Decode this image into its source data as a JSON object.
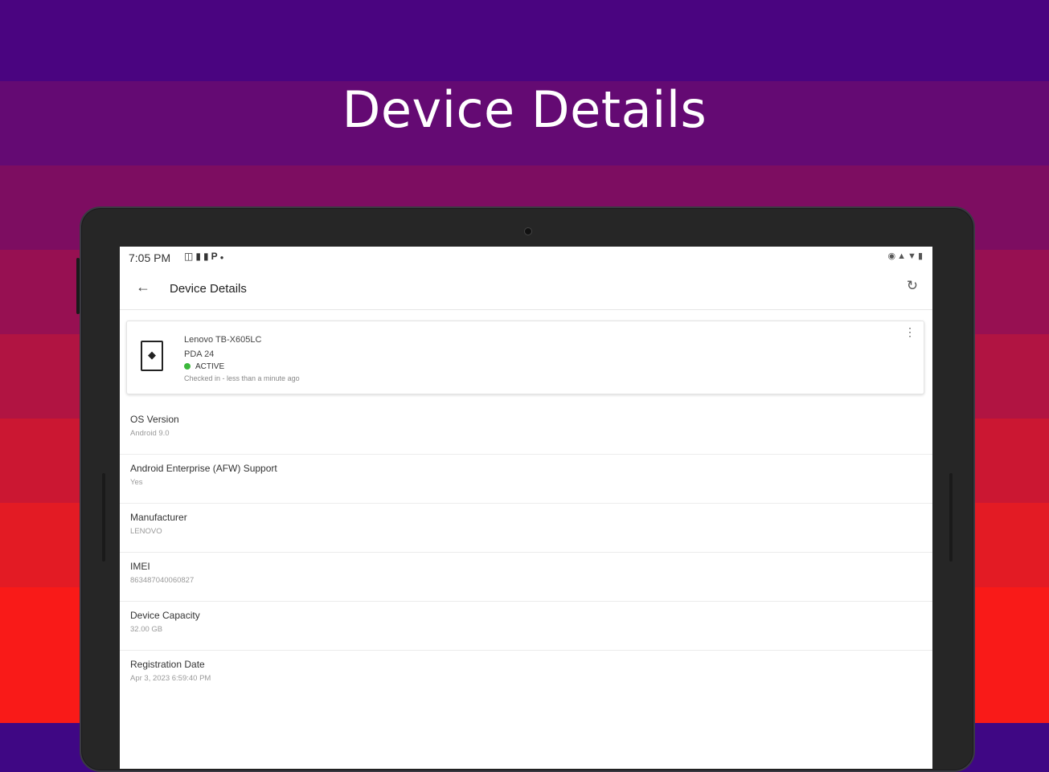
{
  "hero": {
    "title": "Device Details"
  },
  "colors": {
    "bands": [
      "#4a0480",
      "#640a73",
      "#7d0d61",
      "#971052",
      "#b11442",
      "#cb1732",
      "#e31b24",
      "#f91a18"
    ],
    "accent_active": "#3cb83c"
  },
  "status_bar": {
    "time": "7:05 PM",
    "left_icons": [
      "sim-icon",
      "folder-icon",
      "folder-icon",
      "parking-icon",
      "dot-icon"
    ],
    "right_icons": [
      "camera-icon",
      "signal-icon",
      "wifi-icon",
      "battery-icon"
    ]
  },
  "app_bar": {
    "title": "Device Details",
    "back_icon": "arrow-back-icon",
    "refresh_icon": "refresh-icon"
  },
  "device_card": {
    "model": "Lenovo TB-X605LC",
    "label": "PDA 24",
    "status": "ACTIVE",
    "checked_in": "Checked in - less than a minute ago",
    "icon": "android-tablet-icon",
    "menu_icon": "more-vert-icon"
  },
  "details": [
    {
      "label": "OS Version",
      "value": "Android 9.0"
    },
    {
      "label": "Android Enterprise (AFW) Support",
      "value": "Yes"
    },
    {
      "label": "Manufacturer",
      "value": "LENOVO"
    },
    {
      "label": "IMEI",
      "value": "863487040060827"
    },
    {
      "label": "Device Capacity",
      "value": "32.00 GB"
    },
    {
      "label": "Registration Date",
      "value": "Apr 3, 2023 6:59:40 PM"
    }
  ]
}
